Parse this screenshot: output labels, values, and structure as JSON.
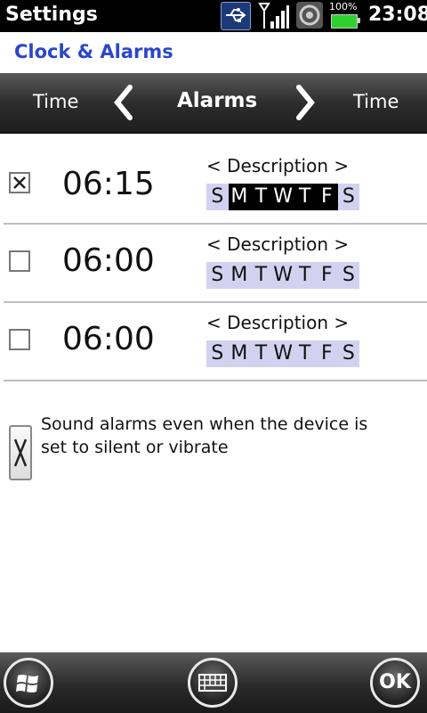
{
  "status_bar": {
    "title": "Settings",
    "battery_percent": "100%",
    "time": "23:08",
    "icons": [
      "usb-icon",
      "signal-icon",
      "sound-icon",
      "battery-icon"
    ]
  },
  "header": {
    "title": "Clock & Alarms"
  },
  "tabs": {
    "left": "Time",
    "current": "Alarms",
    "right": "Time"
  },
  "alarms": [
    {
      "checked": true,
      "time": "06:15",
      "description": "< Description >",
      "days": [
        {
          "label": "S",
          "on": false
        },
        {
          "label": "M",
          "on": true
        },
        {
          "label": "T",
          "on": true
        },
        {
          "label": "W",
          "on": true
        },
        {
          "label": "T",
          "on": true
        },
        {
          "label": "F",
          "on": true
        },
        {
          "label": "S",
          "on": false
        }
      ]
    },
    {
      "checked": false,
      "time": "06:00",
      "description": "< Description >",
      "days": [
        {
          "label": "S",
          "on": false
        },
        {
          "label": "M",
          "on": false
        },
        {
          "label": "T",
          "on": false
        },
        {
          "label": "W",
          "on": false
        },
        {
          "label": "T",
          "on": false
        },
        {
          "label": "F",
          "on": false
        },
        {
          "label": "S",
          "on": false
        }
      ]
    },
    {
      "checked": false,
      "time": "06:00",
      "description": "< Description >",
      "days": [
        {
          "label": "S",
          "on": false
        },
        {
          "label": "M",
          "on": false
        },
        {
          "label": "T",
          "on": false
        },
        {
          "label": "W",
          "on": false
        },
        {
          "label": "T",
          "on": false
        },
        {
          "label": "F",
          "on": false
        },
        {
          "label": "S",
          "on": false
        }
      ]
    }
  ],
  "silent_option": {
    "checked": true,
    "label": "Sound alarms even when the device is set to silent or vibrate"
  },
  "bottom_bar": {
    "ok_label": "OK",
    "icons": [
      "windows-start-icon",
      "keyboard-icon"
    ]
  },
  "colors": {
    "title_blue": "#2b47c8",
    "day_bg": "#d2d2f0",
    "day_on_bg": "#000000",
    "battery_green": "#2fd12f"
  }
}
